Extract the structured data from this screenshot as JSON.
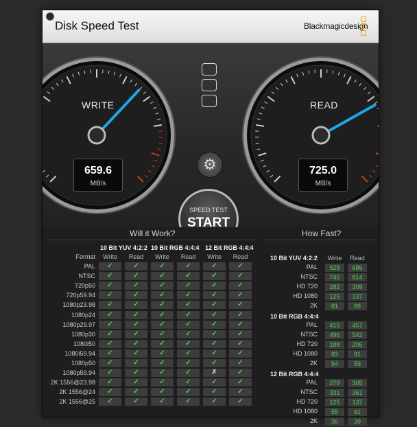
{
  "app": {
    "title": "Disk Speed Test",
    "brand": "Blackmagicdesign"
  },
  "write": {
    "label": "WRITE",
    "value": "659.6",
    "unit": "MB/s"
  },
  "read": {
    "label": "READ",
    "value": "725.0",
    "unit": "MB/s"
  },
  "start": {
    "small": "SPEED TEST",
    "big": "START"
  },
  "will_it_work": {
    "title": "Will it Work?",
    "format_header": "Format",
    "groups": [
      "10 Bit YUV 4:2:2",
      "10 Bit RGB 4:4:4",
      "12 Bit RGB 4:4:4"
    ],
    "sub_headers": [
      "Write",
      "Read"
    ],
    "rows": [
      {
        "format": "PAL",
        "cells": [
          "✓",
          "✓",
          "✓",
          "✓",
          "✓",
          "✓"
        ]
      },
      {
        "format": "NTSC",
        "cells": [
          "✓",
          "✓",
          "✓",
          "✓",
          "✓",
          "✓"
        ]
      },
      {
        "format": "720p50",
        "cells": [
          "✓",
          "✓",
          "✓",
          "✓",
          "✓",
          "✓"
        ]
      },
      {
        "format": "720p59.94",
        "cells": [
          "✓",
          "✓",
          "✓",
          "✓",
          "✓",
          "✓"
        ]
      },
      {
        "format": "1080p23.98",
        "cells": [
          "✓",
          "✓",
          "✓",
          "✓",
          "✓",
          "✓"
        ]
      },
      {
        "format": "1080p24",
        "cells": [
          "✓",
          "✓",
          "✓",
          "✓",
          "✓",
          "✓"
        ]
      },
      {
        "format": "1080p29.97",
        "cells": [
          "✓",
          "✓",
          "✓",
          "✓",
          "✓",
          "✓"
        ]
      },
      {
        "format": "1080p30",
        "cells": [
          "✓",
          "✓",
          "✓",
          "✓",
          "✓",
          "✓"
        ]
      },
      {
        "format": "1080i50",
        "cells": [
          "✓",
          "✓",
          "✓",
          "✓",
          "✓",
          "✓"
        ]
      },
      {
        "format": "1080i59.94",
        "cells": [
          "✓",
          "✓",
          "✓",
          "✓",
          "✓",
          "✓"
        ]
      },
      {
        "format": "1080p50",
        "cells": [
          "✓",
          "✓",
          "✓",
          "✓",
          "✓",
          "✓"
        ]
      },
      {
        "format": "1080p59.94",
        "cells": [
          "✓",
          "✓",
          "✓",
          "✓",
          "✗",
          "✓"
        ]
      },
      {
        "format": "2K 1556@23.98",
        "cells": [
          "✓",
          "✓",
          "✓",
          "✓",
          "✓",
          "✓"
        ]
      },
      {
        "format": "2K 1556@24",
        "cells": [
          "✓",
          "✓",
          "✓",
          "✓",
          "✓",
          "✓"
        ]
      },
      {
        "format": "2K 1556@25",
        "cells": [
          "✓",
          "✓",
          "✓",
          "✓",
          "✓",
          "✓"
        ]
      }
    ]
  },
  "how_fast": {
    "title": "How Fast?",
    "sub_headers": [
      "Write",
      "Read"
    ],
    "groups": [
      {
        "name": "10 Bit YUV 4:2:2",
        "rows": [
          {
            "format": "PAL",
            "write": "628",
            "read": "686"
          },
          {
            "format": "NTSC",
            "write": "745",
            "read": "814"
          },
          {
            "format": "HD 720",
            "write": "282",
            "read": "309"
          },
          {
            "format": "HD 1080",
            "write": "125",
            "read": "137"
          },
          {
            "format": "2K",
            "write": "81",
            "read": "89"
          }
        ]
      },
      {
        "name": "10 Bit RGB 4:4:4",
        "rows": [
          {
            "format": "PAL",
            "write": "419",
            "read": "457"
          },
          {
            "format": "NTSC",
            "write": "496",
            "read": "542"
          },
          {
            "format": "HD 720",
            "write": "188",
            "read": "206"
          },
          {
            "format": "HD 1080",
            "write": "83",
            "read": "91"
          },
          {
            "format": "2K",
            "write": "54",
            "read": "59"
          }
        ]
      },
      {
        "name": "12 Bit RGB 4:4:4",
        "rows": [
          {
            "format": "PAL",
            "write": "279",
            "read": "305"
          },
          {
            "format": "NTSC",
            "write": "331",
            "read": "361"
          },
          {
            "format": "HD 720",
            "write": "125",
            "read": "137"
          },
          {
            "format": "HD 1080",
            "write": "55",
            "read": "61"
          },
          {
            "format": "2K",
            "write": "36",
            "read": "39"
          }
        ]
      }
    ]
  },
  "colors": {
    "check": "#4fd34f",
    "needle": "#1aa8ea",
    "redline": "#d23a1a",
    "accent": "#e7a125"
  }
}
